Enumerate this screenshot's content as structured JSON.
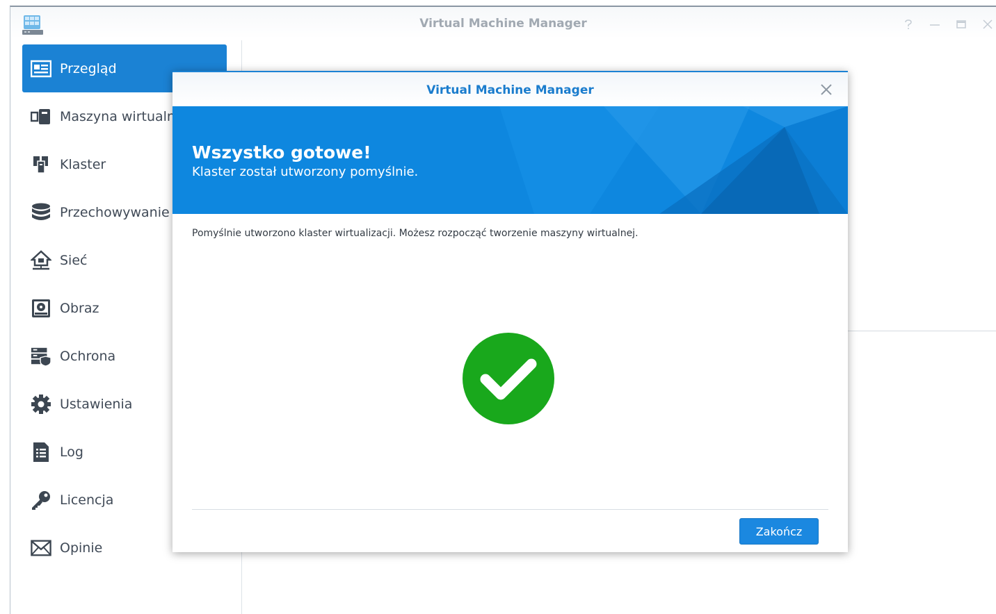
{
  "window": {
    "title": "Virtual Machine Manager",
    "controls": [
      "help-icon",
      "minimize-icon",
      "maximize-icon",
      "close-icon"
    ]
  },
  "sidebar": {
    "items": [
      {
        "label": "Przegląd",
        "icon": "overview-icon",
        "active": true
      },
      {
        "label": "Maszyna wirtualna",
        "icon": "virtual-machine-icon",
        "active": false
      },
      {
        "label": "Klaster",
        "icon": "cluster-icon",
        "active": false
      },
      {
        "label": "Przechowywanie",
        "icon": "storage-icon",
        "active": false
      },
      {
        "label": "Sieć",
        "icon": "network-icon",
        "active": false
      },
      {
        "label": "Obraz",
        "icon": "image-icon",
        "active": false
      },
      {
        "label": "Ochrona",
        "icon": "protection-icon",
        "active": false
      },
      {
        "label": "Ustawienia",
        "icon": "settings-icon",
        "active": false
      },
      {
        "label": "Log",
        "icon": "log-icon",
        "active": false
      },
      {
        "label": "Licencja",
        "icon": "license-key-icon",
        "active": false
      },
      {
        "label": "Opinie",
        "icon": "feedback-mail-icon",
        "active": false
      }
    ]
  },
  "dialog": {
    "title": "Virtual Machine Manager",
    "banner_heading": "Wszystko gotowe!",
    "banner_subheading": "Klaster został utworzony pomyślnie.",
    "message": "Pomyślnie utworzono klaster wirtualizacji. Możesz rozpocząć tworzenie maszyny wirtualnej.",
    "status_icon": "success-check-icon",
    "finish_label": "Zakończ"
  },
  "colors": {
    "accent": "#1b82d4",
    "banner": "#0f88e0",
    "success": "#19a81c",
    "dialog_title": "#1a7ccd"
  }
}
